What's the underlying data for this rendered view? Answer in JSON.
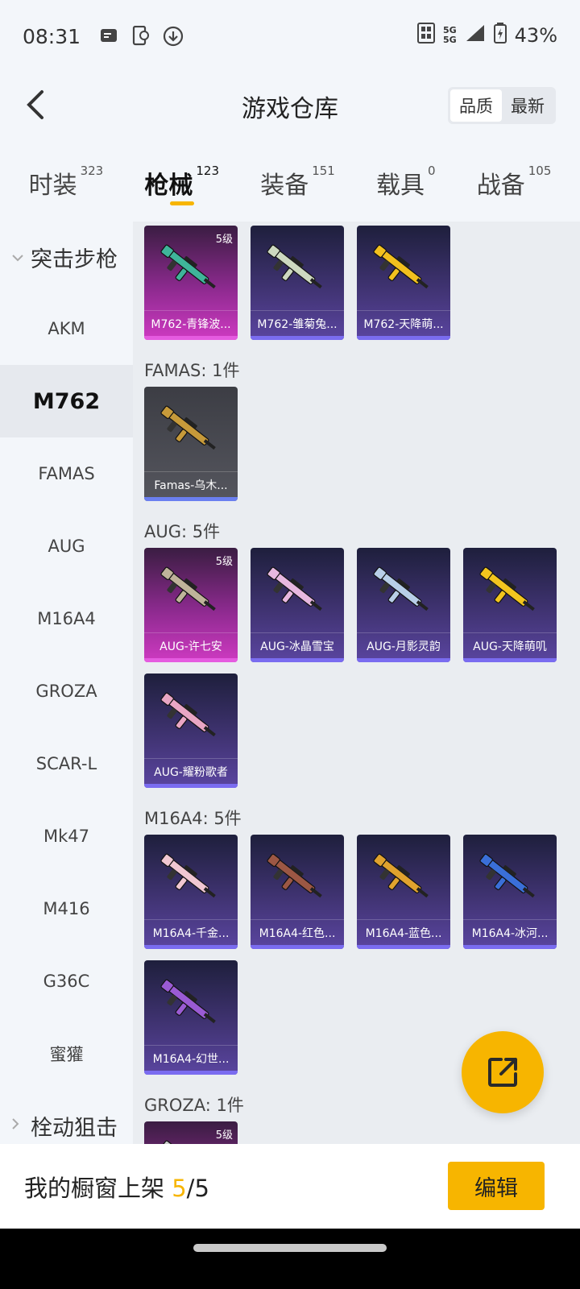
{
  "status": {
    "time": "08:31",
    "battery": "43%",
    "network": "5G"
  },
  "header": {
    "title": "游戏仓库",
    "sort_options": [
      "品质",
      "最新"
    ],
    "active_sort": "品质"
  },
  "tabs": [
    {
      "label": "时装",
      "count": "323"
    },
    {
      "label": "枪械",
      "count": "123"
    },
    {
      "label": "装备",
      "count": "151"
    },
    {
      "label": "载具",
      "count": "0"
    },
    {
      "label": "战备",
      "count": "105"
    }
  ],
  "sidebar": {
    "category": "突击步枪",
    "items": [
      "AKM",
      "M762",
      "FAMAS",
      "AUG",
      "M16A4",
      "GROZA",
      "SCAR-L",
      "Mk47",
      "M416",
      "G36C",
      "蜜獾"
    ],
    "next_category": "栓动狙击",
    "active": "M762"
  },
  "content": {
    "m762": [
      {
        "name": "M762-青锋波...",
        "level": "5级",
        "color": "#3fb59a"
      },
      {
        "name": "M762-雏菊兔...",
        "color": "#cdd8c0"
      },
      {
        "name": "M762-天降萌...",
        "color": "#f2c01e"
      }
    ],
    "famas_title": "FAMAS: 1件",
    "famas": [
      {
        "name": "Famas-乌木...",
        "color": "#c79a3a"
      }
    ],
    "aug_title": "AUG: 5件",
    "aug": [
      {
        "name": "AUG-许七安",
        "level": "5级",
        "color": "#bfb39a"
      },
      {
        "name": "AUG-冰晶雪宝",
        "color": "#e7b8e0"
      },
      {
        "name": "AUG-月影灵韵",
        "color": "#b8cfe8"
      },
      {
        "name": "AUG-天降萌叽",
        "color": "#f2c51e"
      },
      {
        "name": "AUG-耀粉歌者",
        "color": "#e9a6c4"
      }
    ],
    "m16_title": "M16A4: 5件",
    "m16": [
      {
        "name": "M16A4-千金...",
        "color": "#f0c7d2"
      },
      {
        "name": "M16A4-红色...",
        "color": "#9c5744"
      },
      {
        "name": "M16A4-蓝色...",
        "color": "#e0a22e"
      },
      {
        "name": "M16A4-冰河...",
        "color": "#3a6fd8"
      },
      {
        "name": "M16A4-幻世...",
        "color": "#9a5bd3"
      }
    ],
    "groza_title": "GROZA: 1件",
    "groza": [
      {
        "name": "",
        "level": "5级",
        "color": "#cccccc"
      }
    ]
  },
  "footer": {
    "label_prefix": "我的橱窗上架 ",
    "current": "5",
    "total": "/5",
    "edit": "编辑"
  }
}
